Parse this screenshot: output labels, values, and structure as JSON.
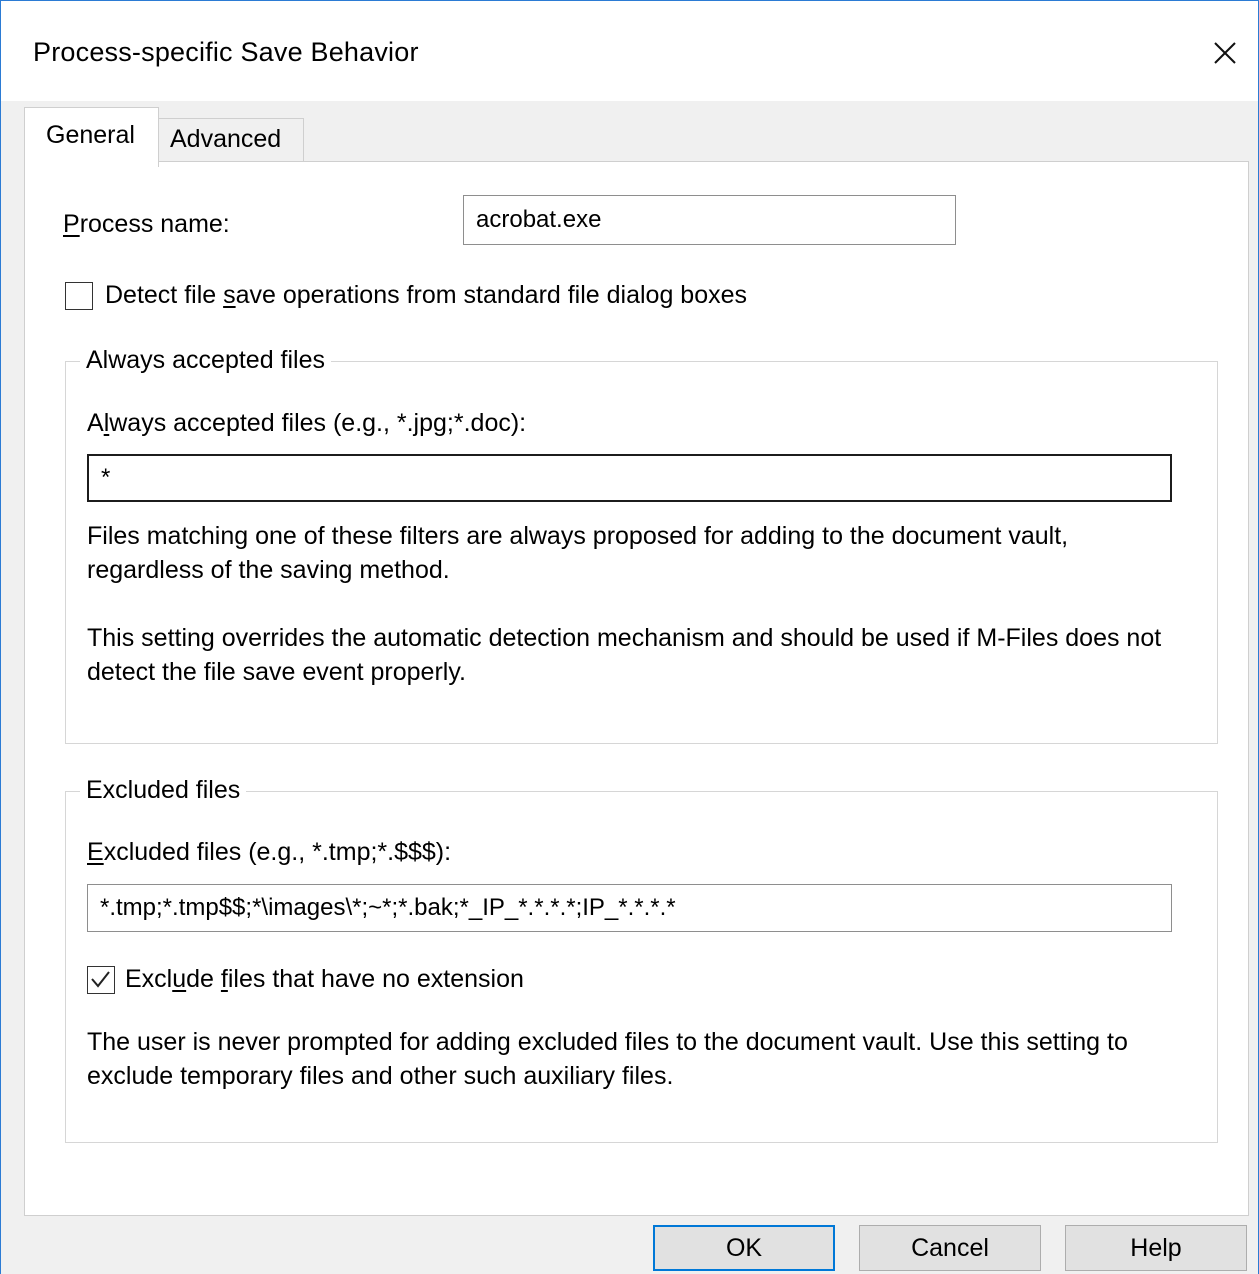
{
  "window": {
    "title": "Process-specific Save Behavior"
  },
  "icons": {
    "close": "close-icon",
    "check": "checkmark-icon"
  },
  "tabs": [
    {
      "label": "General",
      "active": true
    },
    {
      "label": "Advanced",
      "active": false
    }
  ],
  "general": {
    "process_name_label": "Process name:",
    "process_name_value": "acrobat.exe",
    "detect_checkbox_label": "Detect file save operations from standard file dialog boxes",
    "detect_checked": false,
    "accepted_group": {
      "title": "Always accepted files",
      "field_label": "Always accepted files (e.g., *.jpg;*.doc):",
      "field_value": "*",
      "paragraph1": "Files matching one of these filters are always proposed for adding to the document vault, regardless of the saving method.",
      "paragraph2": "This setting overrides the automatic detection mechanism and should be used if M-Files does not detect the file save event properly."
    },
    "excluded_group": {
      "title": "Excluded files",
      "field_label": "Excluded files (e.g., *.tmp;*.$$$):",
      "field_value": "*.tmp;*.tmp$$;*\\images\\*;~*;*.bak;*_IP_*.*.*.*;IP_*.*.*.*",
      "no_ext_label": "Exclude files that have no extension",
      "no_ext_checked": true,
      "paragraph": "The user is never prompted for adding excluded files to the document vault. Use this setting to exclude temporary files and other such auxiliary files."
    }
  },
  "buttons": {
    "ok": "OK",
    "cancel": "Cancel",
    "help": "Help"
  },
  "colors": {
    "accent": "#0078d7",
    "window_border": "#2b7bd4",
    "background": "#f0f0f0"
  }
}
